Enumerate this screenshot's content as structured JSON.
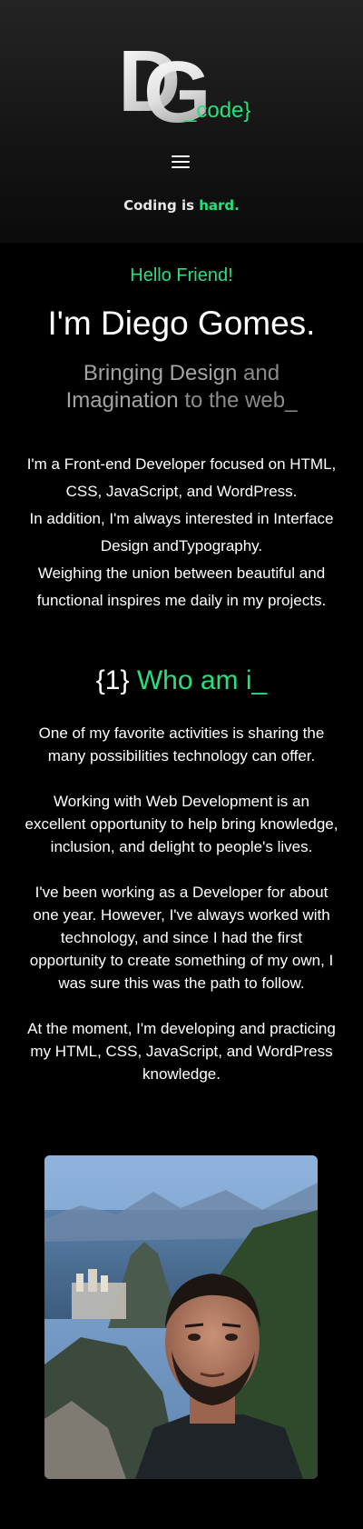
{
  "header": {
    "logo_code": "_code}",
    "tagline_prefix": "Coding is ",
    "tagline_highlight": "hard.",
    "menu_icon": "hamburger-menu-icon"
  },
  "hero": {
    "greeting": "Hello Friend!",
    "name": "I'm Diego Gomes.",
    "slogan": {
      "w1": "Bringing",
      "w2": "Design",
      "w3": "and",
      "w4": "Imagination",
      "w5": "to the web_"
    },
    "intro_lines": [
      "I'm a Front-end Developer focused on HTML,",
      "CSS, JavaScript, and WordPress.",
      "In addition, I'm always interested in Interface",
      "Design andTypography.",
      "Weighing the union between beautiful and",
      "functional inspires me daily in my projects."
    ]
  },
  "about": {
    "number": "{1}",
    "title": "Who am i_",
    "paragraphs": [
      "One of my favorite activities is sharing the many possibilities technology can offer.",
      "Working with Web Development is an excellent opportunity to help bring knowledge, inclusion, and delight to people's lives.",
      "I've been working as a Developer for about one year. However, I've always worked with technology, and since I had the first opportunity to create something of my own, I was sure this was the path to follow.",
      "At the moment, I'm developing and practicing my HTML, CSS, JavaScript, and WordPress knowledge."
    ]
  },
  "colors": {
    "accent": "#26e07c",
    "background": "#000000",
    "text": "#ffffff",
    "muted": "#8a8a8a"
  }
}
